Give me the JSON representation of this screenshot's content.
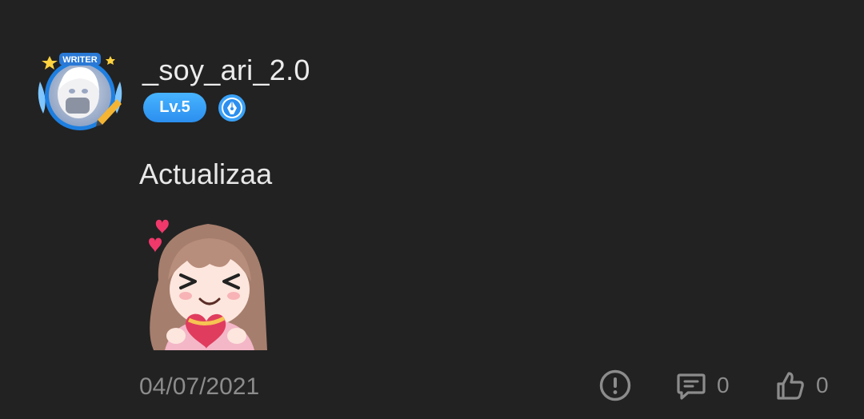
{
  "comment": {
    "avatar_badge_text": "WRITER",
    "username": "_soy_ari_2.0",
    "level": "Lv.5",
    "message": "Actualizaa",
    "date": "04/07/2021",
    "reply_count": "0",
    "like_count": "0"
  },
  "icons": {
    "report": "report-icon",
    "reply": "reply-icon",
    "like": "like-icon",
    "writer": "writer-pen-icon"
  },
  "colors": {
    "background": "#222222",
    "level_badge": "#3aa1f7",
    "muted_text": "#8c8c8c"
  }
}
